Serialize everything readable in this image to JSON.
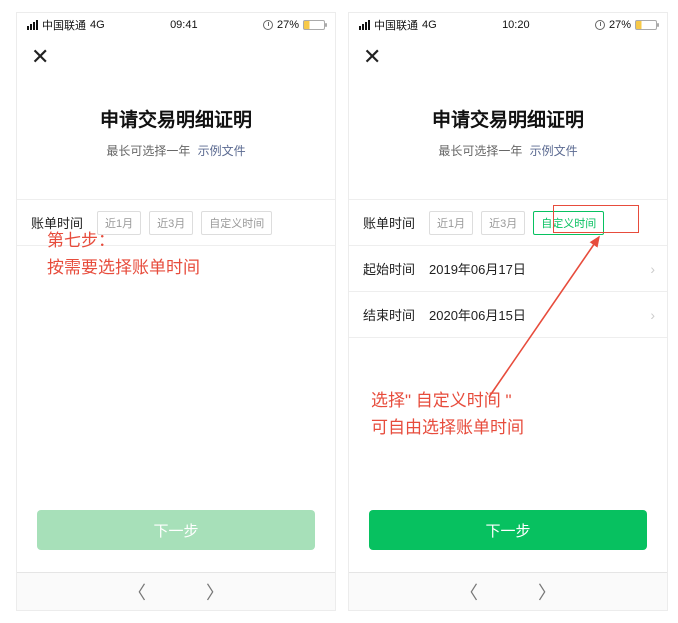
{
  "status": {
    "carrier": "中国联通",
    "network": "4G",
    "timeL": "09:41",
    "timeR": "10:20",
    "battery": "27%"
  },
  "common": {
    "title": "申请交易明细证明",
    "subtitle": "最长可选择一年",
    "exampleLink": "示例文件",
    "billLabel": "账单时间",
    "chipM1": "近1月",
    "chipM3": "近3月",
    "chipCustom": "自定义时间",
    "nextBtn": "下一步"
  },
  "right": {
    "startLabel": "起始时间",
    "startValue": "2019年06月17日",
    "endLabel": "结束时间",
    "endValue": "2020年06月15日"
  },
  "annotations": {
    "left": "第七步：\n按需要选择账单时间",
    "right": "选择\" 自定义时间 \"\n可自由选择账单时间"
  }
}
